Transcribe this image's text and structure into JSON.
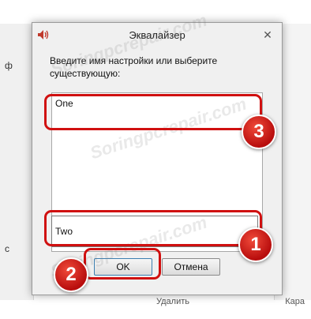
{
  "dialog": {
    "title": "Эквалайзер",
    "close_glyph": "✕",
    "prompt": "Введите имя настройки или выберите существующую:",
    "list_items": [
      "One"
    ],
    "name_value": "Two",
    "ok_label": "OK",
    "cancel_label": "Отмена"
  },
  "annotations": {
    "badge_1": "1",
    "badge_2": "2",
    "badge_3": "3",
    "highlight_color": "#d01010"
  },
  "background": {
    "left_letters": [
      "ф",
      "с"
    ],
    "bottom_text": "Удалить",
    "bottom_right_text": "Кара"
  },
  "watermark": "Soringpcrepair.com",
  "icons": {
    "title_icon": "speaker-icon"
  }
}
